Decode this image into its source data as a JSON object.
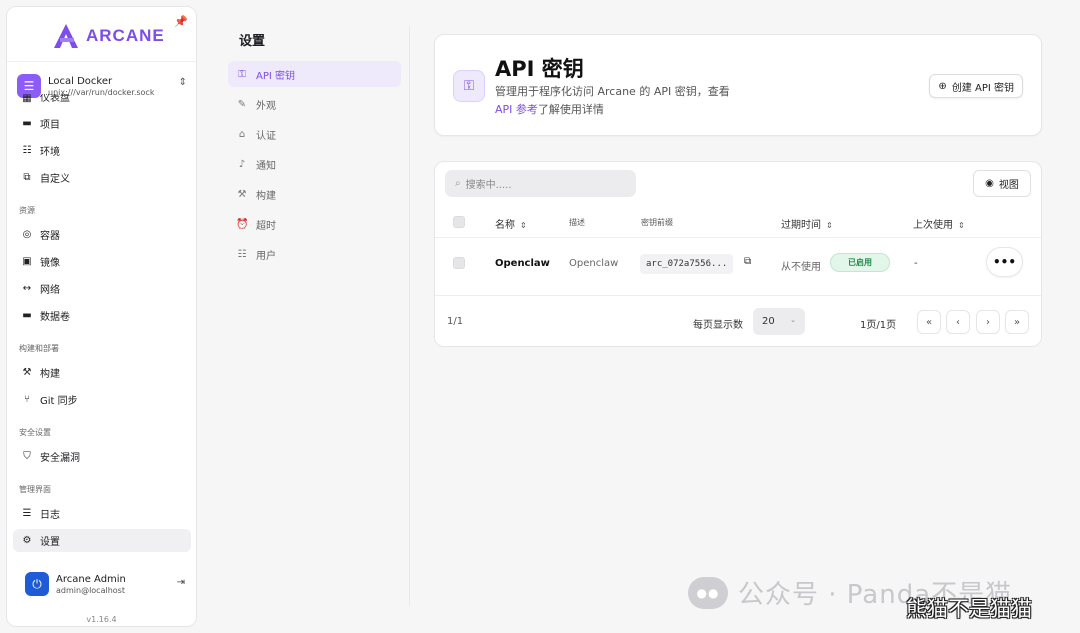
{
  "sidebar": {
    "logo_text": "ARCANE",
    "environment": {
      "name": "Local Docker",
      "socket": "unix:///var/run/docker.sock"
    },
    "top_items": [
      {
        "label": "仪表盘"
      },
      {
        "label": "项目"
      },
      {
        "label": "环境"
      },
      {
        "label": "自定义"
      }
    ],
    "groups": [
      {
        "label": "资源",
        "items": [
          {
            "label": "容器"
          },
          {
            "label": "镜像"
          },
          {
            "label": "网络"
          },
          {
            "label": "数据卷"
          }
        ]
      },
      {
        "label": "构建和部署",
        "items": [
          {
            "label": "构建"
          },
          {
            "label": "Git 同步"
          }
        ]
      },
      {
        "label": "安全设置",
        "items": [
          {
            "label": "安全漏洞"
          }
        ]
      },
      {
        "label": "管理界面",
        "items": [
          {
            "label": "日志"
          },
          {
            "label": "设置"
          }
        ]
      }
    ],
    "user": {
      "name": "Arcane Admin",
      "email": "admin@localhost"
    },
    "version": "v1.16.4"
  },
  "settings": {
    "title": "设置",
    "items": [
      {
        "label": "API 密钥"
      },
      {
        "label": "外观"
      },
      {
        "label": "认证"
      },
      {
        "label": "通知"
      },
      {
        "label": "构建"
      },
      {
        "label": "超时"
      },
      {
        "label": "用户"
      }
    ]
  },
  "hero": {
    "title": "API 密钥",
    "desc_part1": "管理用于程序化访问 Arcane 的 API 密钥，查看",
    "desc_link": "API 参考",
    "desc_part2": "了解使用详情",
    "create_label": "创建 API 密钥"
  },
  "table": {
    "search_placeholder": "搜索中.....",
    "view_label": "视图",
    "headers": {
      "name": "名称",
      "description": "描述",
      "prefix": "密钥前缀",
      "expires": "过期时间",
      "last_used": "上次使用"
    },
    "rows": [
      {
        "name": "Openclaw",
        "description": "Openclaw",
        "prefix": "arc_072a7556...",
        "expires": "从不使用",
        "status": "已启用",
        "last_used": "-"
      }
    ],
    "pagination": {
      "count": "1/1",
      "per_page_label": "每页显示数",
      "per_page": "20",
      "pages": "1页/1页"
    }
  },
  "watermark": {
    "line1": "公众号 · Panda不是猫",
    "line2": "熊猫不是猫猫"
  },
  "colors": {
    "accent": "#7c4de8",
    "success": "#1f8a4c",
    "avatar": "#1e5bd6"
  }
}
